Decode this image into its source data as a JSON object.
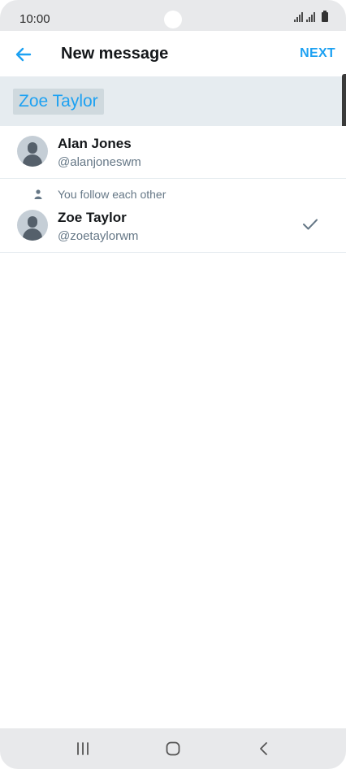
{
  "status_bar": {
    "time": "10:00"
  },
  "app_bar": {
    "title": "New message",
    "next_label": "NEXT",
    "back_icon": "arrow-left-icon"
  },
  "recipient": {
    "chip_label": "Zoe Taylor"
  },
  "users": [
    {
      "name": "Alan Jones",
      "handle": "@alanjoneswm"
    },
    {
      "follow_note": "You follow each other",
      "name": "Zoe Taylor",
      "handle": "@zoetaylorwm",
      "selected": true
    }
  ],
  "colors": {
    "accent": "#1da1f2",
    "secondary_text": "#657786",
    "primary_text": "#14171a",
    "divider": "#e6ecf0"
  },
  "nav_bar": {
    "icons": [
      "recents-icon",
      "home-icon",
      "back-icon"
    ]
  }
}
